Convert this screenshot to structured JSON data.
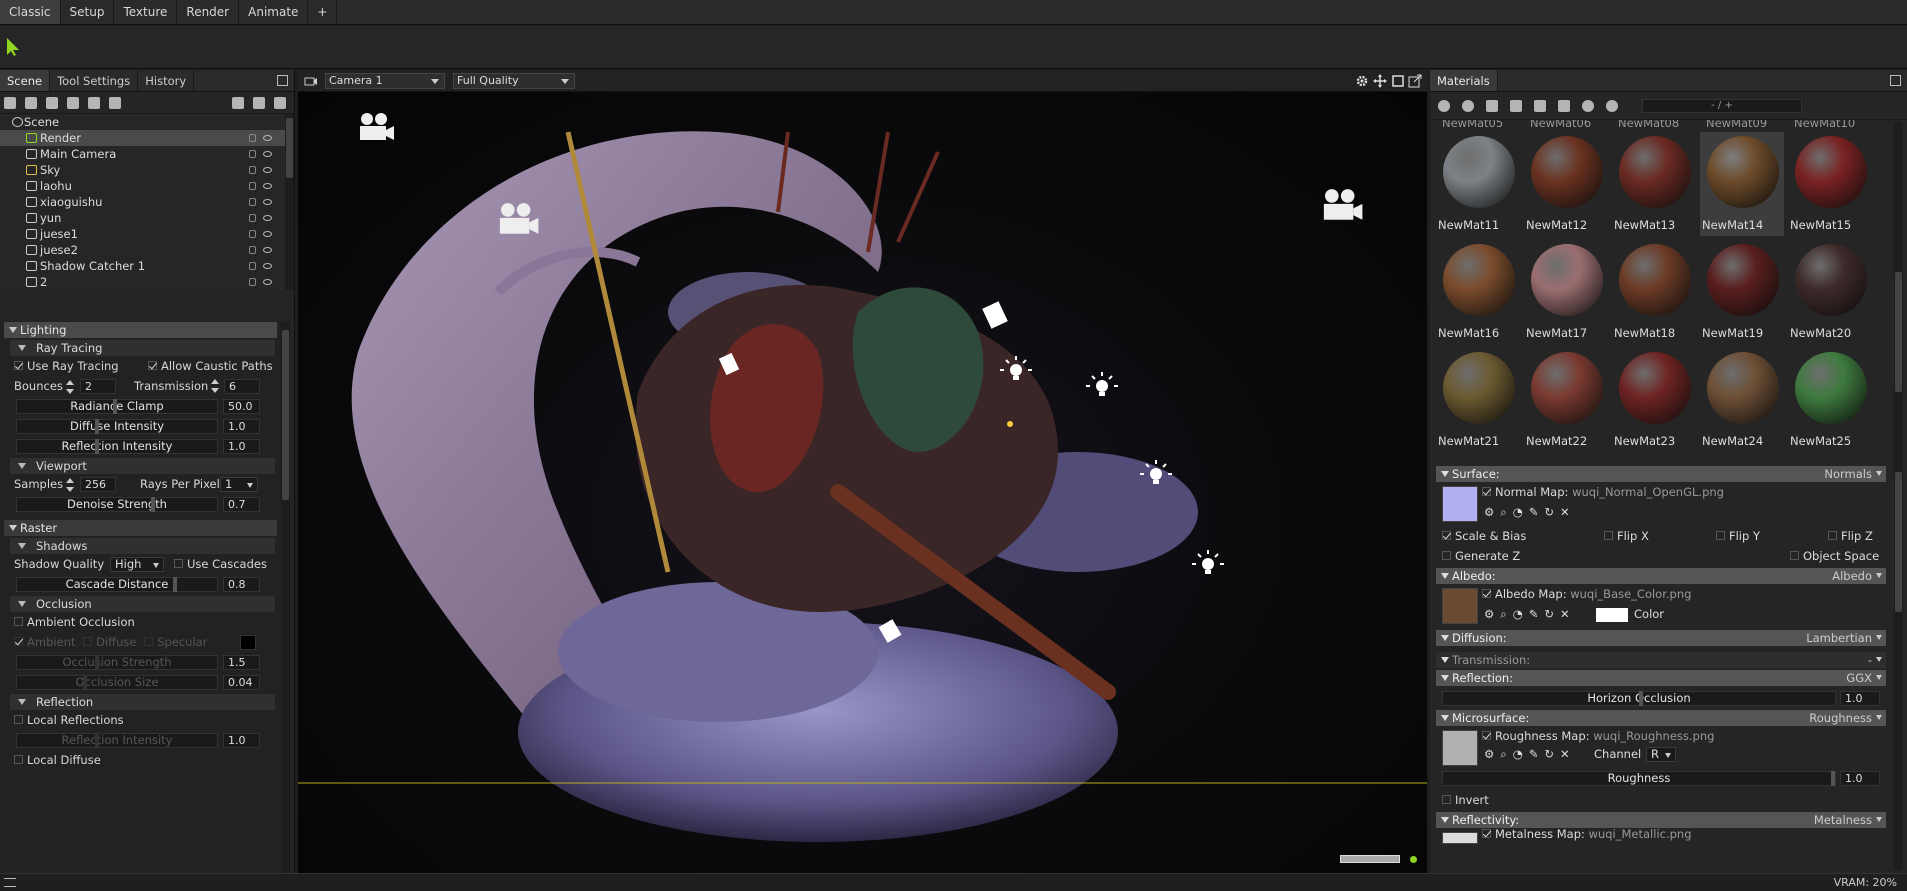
{
  "top_tabs": [
    "Classic",
    "Setup",
    "Texture",
    "Render",
    "Animate",
    "+"
  ],
  "left_panel": {
    "tabs": [
      "Scene",
      "Tool Settings",
      "History"
    ],
    "tree": [
      {
        "label": "Scene",
        "root": true
      },
      {
        "label": "Render",
        "selected": true
      },
      {
        "label": "Main Camera"
      },
      {
        "label": "Sky"
      },
      {
        "label": "laohu"
      },
      {
        "label": "xiaoguishu"
      },
      {
        "label": "yun"
      },
      {
        "label": "juese1"
      },
      {
        "label": "juese2"
      },
      {
        "label": "Shadow Catcher 1"
      },
      {
        "label": "2"
      }
    ],
    "lighting": {
      "title": "Lighting",
      "ray_tracing": {
        "title": "Ray Tracing",
        "use_ray_tracing": "Use Ray Tracing",
        "allow_caustic": "Allow Caustic Paths",
        "bounces_label": "Bounces",
        "bounces": "2",
        "transmission_label": "Transmission",
        "transmission": "6",
        "radiance_clamp_label": "Radiance Clamp",
        "radiance_clamp": "50.0",
        "diffuse_intensity_label": "Diffuse Intensity",
        "diffuse_intensity": "1.0",
        "reflection_intensity_label": "Reflection Intensity",
        "reflection_intensity": "1.0"
      },
      "viewport": {
        "title": "Viewport",
        "samples_label": "Samples",
        "samples": "256",
        "rays_label": "Rays Per Pixel",
        "rays": "1",
        "denoise_label": "Denoise Strength",
        "denoise": "0.7"
      }
    },
    "raster": {
      "title": "Raster",
      "shadows": {
        "title": "Shadows",
        "quality_label": "Shadow Quality",
        "quality": "High",
        "use_cascades": "Use Cascades",
        "cascade_label": "Cascade Distance",
        "cascade": "0.8"
      },
      "occlusion": {
        "title": "Occlusion",
        "ambient": "Ambient Occlusion",
        "ambient_row": "Ambient",
        "diffuse_opt": "Diffuse",
        "specular_opt": "Specular",
        "strength_label": "Occlusion Strength",
        "strength": "1.5",
        "size_label": "Occlusion Size",
        "size": "0.04"
      },
      "reflection": {
        "title": "Reflection",
        "local_reflections": "Local Reflections",
        "intensity_label": "Reflection Intensity",
        "intensity": "1.0",
        "local_diffuse": "Local Diffuse"
      }
    }
  },
  "viewport": {
    "camera": "Camera 1",
    "quality": "Full Quality"
  },
  "materials": {
    "title": "Materials",
    "count": "- / +",
    "top_row": [
      "NewMat05",
      "NewMat06",
      "NewMat08",
      "NewMat09",
      "NewMat10"
    ],
    "swatches": [
      {
        "name": "NewMat11",
        "color": "#7d8286"
      },
      {
        "name": "NewMat12",
        "color": "#6a3220"
      },
      {
        "name": "NewMat13",
        "color": "#6a2a22"
      },
      {
        "name": "NewMat14",
        "color": "#6d4b2a",
        "active": true
      },
      {
        "name": "NewMat15",
        "color": "#7a2222"
      },
      {
        "name": "NewMat16",
        "color": "#7a4c2c"
      },
      {
        "name": "NewMat17",
        "color": "#9b6e70"
      },
      {
        "name": "NewMat18",
        "color": "#6b3b26"
      },
      {
        "name": "NewMat19",
        "color": "#5a1e1e"
      },
      {
        "name": "NewMat20",
        "color": "#3e2a2a"
      },
      {
        "name": "NewMat21",
        "color": "#6b5a30"
      },
      {
        "name": "NewMat22",
        "color": "#7a3a30"
      },
      {
        "name": "NewMat23",
        "color": "#6e2422"
      },
      {
        "name": "NewMat24",
        "color": "#6d4f35"
      },
      {
        "name": "NewMat25",
        "color": "#3e7a3e"
      }
    ],
    "surface": {
      "title": "Surface:",
      "mode": "Normals",
      "map_label": "Normal Map:",
      "map": "wuqi_Normal_OpenGL.png",
      "scale_bias": "Scale & Bias",
      "flip_x": "Flip X",
      "flip_y": "Flip Y",
      "flip_z": "Flip Z",
      "generate_z": "Generate Z",
      "object_space": "Object Space"
    },
    "albedo": {
      "title": "Albedo:",
      "mode": "Albedo",
      "map_label": "Albedo Map:",
      "map": "wuqi_Base_Color.png",
      "color_label": "Color"
    },
    "diffusion": {
      "title": "Diffusion:",
      "mode": "Lambertian"
    },
    "transmission": {
      "title": "Transmission:",
      "mode": "-"
    },
    "reflection": {
      "title": "Reflection:",
      "mode": "GGX",
      "horizon_label": "Horizon Occlusion",
      "horizon": "1.0"
    },
    "microsurface": {
      "title": "Microsurface:",
      "mode": "Roughness",
      "map_label": "Roughness Map:",
      "map": "wuqi_Roughness.png",
      "channel_label": "Channel",
      "channel": "R",
      "roughness_label": "Roughness",
      "roughness": "1.0",
      "invert": "Invert"
    },
    "reflectivity": {
      "title": "Reflectivity:",
      "mode": "Metalness",
      "map_label": "Metalness Map:",
      "map": "wuqi_Metallic.png"
    }
  },
  "status": {
    "vram": "VRAM: 20%"
  }
}
